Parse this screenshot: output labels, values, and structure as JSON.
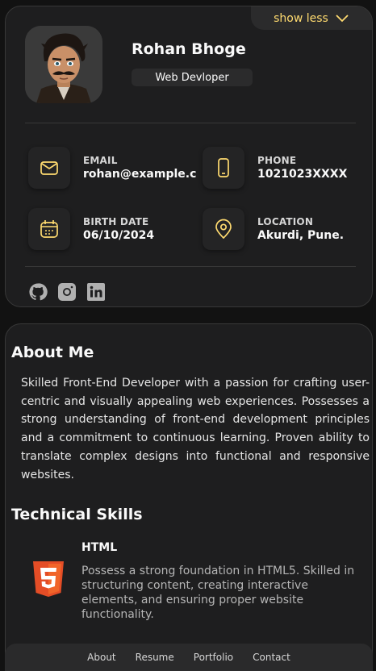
{
  "profile": {
    "name": "Rohan Bhoge",
    "title": "Web Devloper",
    "toggle_label": "show less"
  },
  "contacts": [
    {
      "title": "EMAIL",
      "value": "rohan@example.com",
      "icon": "mail-icon"
    },
    {
      "title": "PHONE",
      "value": "1021023XXXX",
      "icon": "phone-icon"
    },
    {
      "title": "BIRTH DATE",
      "value": "06/10/2024",
      "icon": "calendar-icon"
    },
    {
      "title": "LOCATION",
      "value": "Akurdi, Pune.",
      "icon": "location-icon"
    }
  ],
  "social": [
    "github-icon",
    "instagram-icon",
    "linkedin-icon"
  ],
  "about": {
    "heading": "About Me",
    "text": "Skilled Front-End Developer with a passion for crafting user-centric and visually appealing web experiences. Possesses a strong understanding of front-end development principles and a commitment to continuous learning. Proven ability to translate complex designs into functional and responsive websites."
  },
  "skills": {
    "heading": "Technical Skills",
    "items": [
      {
        "name": "HTML",
        "description": "Possess a strong foundation in HTML5. Skilled in structuring content, creating interactive elements, and ensuring proper website functionality.",
        "icon": "html5-icon"
      }
    ]
  },
  "nav": [
    "About",
    "Resume",
    "Portfolio",
    "Contact"
  ],
  "colors": {
    "accent": "#ffdb70",
    "card": "#1e1e1f",
    "background": "#121212"
  }
}
